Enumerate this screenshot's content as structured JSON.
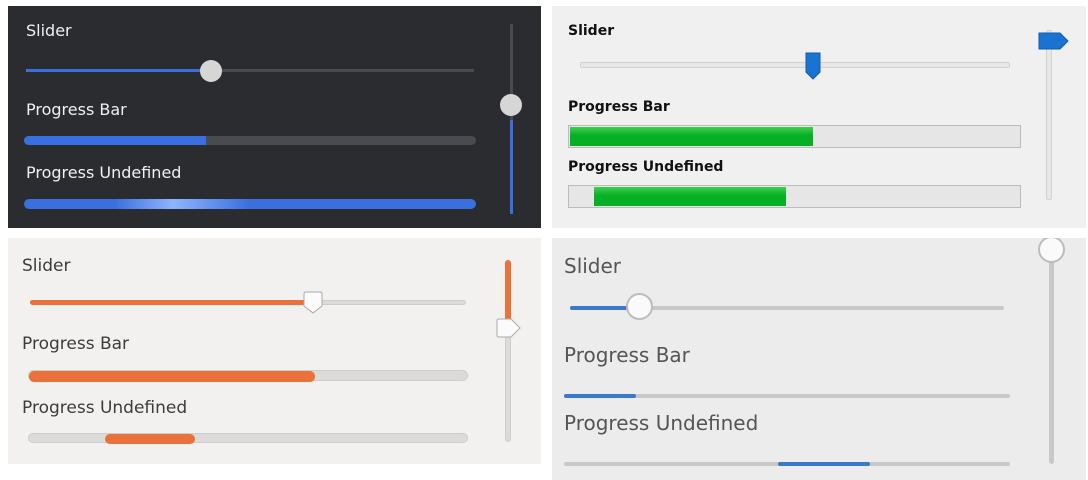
{
  "panels": {
    "dark": {
      "slider_label": "Slider",
      "progress_label": "Progress Bar",
      "undefined_label": "Progress Undefined",
      "slider_value": 0.41,
      "progress_value": 0.4,
      "vertical_slider_value": 0.52,
      "accent": "#3a6fe0"
    },
    "classic": {
      "slider_label": "Slider",
      "progress_label": "Progress Bar",
      "undefined_label": "Progress Undefined",
      "slider_value": 0.54,
      "progress_value": 0.54,
      "vertical_slider_value": 1.0,
      "accent": "#06b025"
    },
    "orange": {
      "slider_label": "Slider",
      "progress_label": "Progress Bar",
      "undefined_label": "Progress Undefined",
      "slider_value": 0.65,
      "progress_value": 0.65,
      "vertical_slider_value": 0.63,
      "accent": "#e8723a"
    },
    "light": {
      "slider_label": "Slider",
      "progress_label": "Progress Bar",
      "undefined_label": "Progress Undefined",
      "slider_value": 0.16,
      "progress_value": 0.16,
      "vertical_slider_value": 1.0,
      "accent": "#3a78d0"
    }
  }
}
